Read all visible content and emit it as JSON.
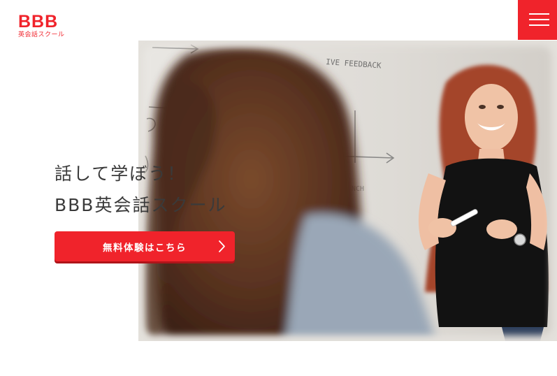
{
  "logo": {
    "main": "BBB",
    "sub": "英会話スクール"
  },
  "menu": {
    "icon": "hamburger-menu-icon"
  },
  "hero": {
    "photo_description_icon": "classroom-photo",
    "whiteboard_text": "IVE FEEDBACK",
    "heading_line1": "話して学ぼう！",
    "heading_line2": "BBB英会話スクール",
    "cta_label": "無料体験はこちら",
    "cta_icon": "chevron-right-icon"
  },
  "colors": {
    "accent": "#f0232b",
    "text": "#3a3a3a",
    "background": "#ffffff"
  }
}
